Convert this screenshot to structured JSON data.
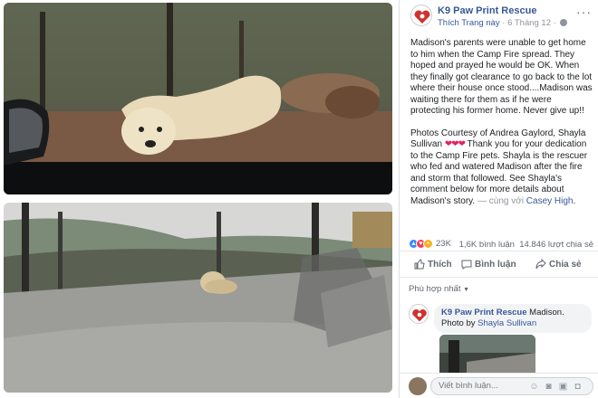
{
  "post": {
    "page_name": "K9 Paw Print Rescue",
    "like_link": "Thích Trang này",
    "separator": " · ",
    "date": "6 Tháng 12",
    "paragraph1": "Madison's parents were unable to get home to him when the Camp Fire spread. They hoped and prayed he would be OK. When they finally got clearance to go back to the lot where their house once stood....Madison was waiting there for them as if he were protecting his former home. Never give up!!",
    "paragraph2_a": "Photos Courtesy of Andrea Gaylord, Shayla Sullivan ",
    "paragraph2_hearts": "❤❤❤",
    "paragraph2_b": " Thank you for your dedication to the Camp Fire pets. Shayla is the rescuer who fed and watered Madison after the fire and storm that followed. See Shayla's comment below for more details about Madison's story.",
    "with_text": " — cùng với ",
    "with_person": "Casey High",
    "with_end": "."
  },
  "stats": {
    "reaction_count": "23K",
    "comments": "1,6K bình luận",
    "shares": "14.846 lượt chia sẻ"
  },
  "actions": {
    "like": "Thích",
    "comment": "Bình luận",
    "share": "Chia sẻ"
  },
  "comments_sort": "Phù hợp nhất",
  "comment": {
    "author": "K9 Paw Print Rescue",
    "text": " Madison. Photo by ",
    "tagged": "Shayla Sullivan"
  },
  "composer": {
    "placeholder": "Viết bình luận..."
  },
  "icons": [
    "more-icon",
    "globe-icon",
    "like-icon",
    "comment-icon",
    "share-icon",
    "emoji-icon",
    "camera-icon",
    "gif-icon",
    "sticker-icon"
  ],
  "colors": {
    "link": "#385898",
    "like_reaction": "#2d88ff",
    "love_reaction": "#f33e58"
  }
}
